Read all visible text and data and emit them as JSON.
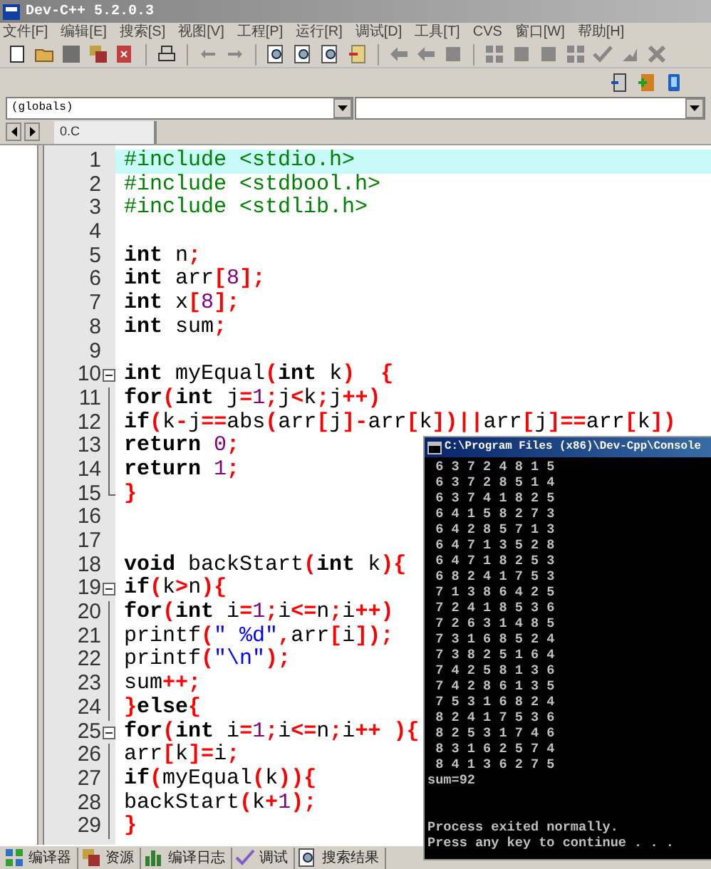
{
  "window": {
    "title": "Dev-C++ 5.2.0.3"
  },
  "menu": [
    "文件[F]",
    "编辑[E]",
    "搜索[S]",
    "视图[V]",
    "工程[P]",
    "运行[R]",
    "调试[D]",
    "工具[T]",
    "CVS",
    "窗口[W]",
    "帮助[H]"
  ],
  "scope_combo": {
    "value": "(globals)"
  },
  "file_tabs": [
    {
      "label": "0.C",
      "selected": true
    }
  ],
  "editor": {
    "lines": [
      {
        "number": "1",
        "current": true,
        "segments": [
          {
            "kind": "pp",
            "text": "#include <stdio.h>"
          }
        ]
      },
      {
        "number": "2",
        "current": false,
        "segments": [
          {
            "kind": "pp",
            "text": "#include <stdbool.h>"
          }
        ]
      },
      {
        "number": "3",
        "current": false,
        "segments": [
          {
            "kind": "pp",
            "text": "#include <stdlib.h>"
          }
        ]
      },
      {
        "number": "4",
        "current": false
      },
      {
        "number": "5",
        "current": false,
        "segments": [
          {
            "kind": "kw",
            "text": "int"
          },
          {
            "kind": "id",
            "text": " n"
          },
          {
            "kind": "sym",
            "text": ";"
          }
        ]
      },
      {
        "number": "6",
        "current": false,
        "segments": [
          {
            "kind": "kw",
            "text": "int"
          },
          {
            "kind": "id",
            "text": " arr"
          },
          {
            "kind": "sym",
            "text": "["
          },
          {
            "kind": "num",
            "text": "8"
          },
          {
            "kind": "sym",
            "text": "];"
          }
        ]
      },
      {
        "number": "7",
        "current": false,
        "segments": [
          {
            "kind": "kw",
            "text": "int"
          },
          {
            "kind": "id",
            "text": " x"
          },
          {
            "kind": "sym",
            "text": "["
          },
          {
            "kind": "num",
            "text": "8"
          },
          {
            "kind": "sym",
            "text": "];"
          }
        ]
      },
      {
        "number": "8",
        "current": false,
        "segments": [
          {
            "kind": "kw",
            "text": "int"
          },
          {
            "kind": "id",
            "text": " sum"
          },
          {
            "kind": "sym",
            "text": ";"
          }
        ]
      },
      {
        "number": "9",
        "current": false
      },
      {
        "number": "10",
        "current": false,
        "kind": "fold_start",
        "segments": [
          {
            "kind": "kw",
            "text": "int"
          },
          {
            "kind": "id",
            "text": " myEqual"
          },
          {
            "kind": "sym",
            "text": "("
          },
          {
            "kind": "kw",
            "text": "int"
          },
          {
            "kind": "id",
            "text": " k"
          },
          {
            "kind": "sym",
            "text": ")  {"
          }
        ]
      },
      {
        "number": "11",
        "current": false,
        "kind": "fold_inner",
        "segments": [
          {
            "kind": "kw",
            "text": "for"
          },
          {
            "kind": "sym",
            "text": "("
          },
          {
            "kind": "kw",
            "text": "int"
          },
          {
            "kind": "id",
            "text": " j"
          },
          {
            "kind": "sym",
            "text": "="
          },
          {
            "kind": "num",
            "text": "1"
          },
          {
            "kind": "sym",
            "text": ";"
          },
          {
            "kind": "id",
            "text": "j"
          },
          {
            "kind": "sym",
            "text": "<"
          },
          {
            "kind": "id",
            "text": "k"
          },
          {
            "kind": "sym",
            "text": ";"
          },
          {
            "kind": "id",
            "text": "j"
          },
          {
            "kind": "sym",
            "text": "++)"
          }
        ]
      },
      {
        "number": "12",
        "current": false,
        "kind": "fold_inner",
        "segments": [
          {
            "kind": "kw",
            "text": "if"
          },
          {
            "kind": "sym",
            "text": "("
          },
          {
            "kind": "id",
            "text": "k"
          },
          {
            "kind": "sym",
            "text": "-"
          },
          {
            "kind": "id",
            "text": "j"
          },
          {
            "kind": "sym",
            "text": "=="
          },
          {
            "kind": "id",
            "text": "abs"
          },
          {
            "kind": "sym",
            "text": "("
          },
          {
            "kind": "id",
            "text": "arr"
          },
          {
            "kind": "sym",
            "text": "["
          },
          {
            "kind": "id",
            "text": "j"
          },
          {
            "kind": "sym",
            "text": "]-"
          },
          {
            "kind": "id",
            "text": "arr"
          },
          {
            "kind": "sym",
            "text": "["
          },
          {
            "kind": "id",
            "text": "k"
          },
          {
            "kind": "sym",
            "text": "])||"
          },
          {
            "kind": "id",
            "text": "arr"
          },
          {
            "kind": "sym",
            "text": "["
          },
          {
            "kind": "id",
            "text": "j"
          },
          {
            "kind": "sym",
            "text": "]=="
          },
          {
            "kind": "id",
            "text": "arr"
          },
          {
            "kind": "sym",
            "text": "["
          },
          {
            "kind": "id",
            "text": "k"
          },
          {
            "kind": "sym",
            "text": "])"
          }
        ]
      },
      {
        "number": "13",
        "current": false,
        "kind": "fold_inner",
        "segments": [
          {
            "kind": "kw",
            "text": "return"
          },
          {
            "kind": "num",
            "text": " 0"
          },
          {
            "kind": "sym",
            "text": ";"
          }
        ]
      },
      {
        "number": "14",
        "current": false,
        "kind": "fold_inner",
        "segments": [
          {
            "kind": "kw",
            "text": "return"
          },
          {
            "kind": "num",
            "text": " 1"
          },
          {
            "kind": "sym",
            "text": ";"
          }
        ]
      },
      {
        "number": "15",
        "current": false,
        "kind": "fold_end",
        "segments": [
          {
            "kind": "sym",
            "text": "}"
          }
        ]
      },
      {
        "number": "16",
        "current": false
      },
      {
        "number": "17",
        "current": false
      },
      {
        "number": "18",
        "current": false,
        "segments": [
          {
            "kind": "kw",
            "text": "void"
          },
          {
            "kind": "id",
            "text": " backStart"
          },
          {
            "kind": "sym",
            "text": "("
          },
          {
            "kind": "kw",
            "text": "int"
          },
          {
            "kind": "id",
            "text": " k"
          },
          {
            "kind": "sym",
            "text": "){"
          }
        ]
      },
      {
        "number": "19",
        "current": false,
        "kind": "fold_start",
        "segments": [
          {
            "kind": "kw",
            "text": "if"
          },
          {
            "kind": "sym",
            "text": "("
          },
          {
            "kind": "id",
            "text": "k"
          },
          {
            "kind": "sym",
            "text": ">"
          },
          {
            "kind": "id",
            "text": "n"
          },
          {
            "kind": "sym",
            "text": "){"
          }
        ]
      },
      {
        "number": "20",
        "current": false,
        "kind": "fold_inner",
        "segments": [
          {
            "kind": "kw",
            "text": "for"
          },
          {
            "kind": "sym",
            "text": "("
          },
          {
            "kind": "kw",
            "text": "int"
          },
          {
            "kind": "id",
            "text": " i"
          },
          {
            "kind": "sym",
            "text": "="
          },
          {
            "kind": "num",
            "text": "1"
          },
          {
            "kind": "sym",
            "text": ";"
          },
          {
            "kind": "id",
            "text": "i"
          },
          {
            "kind": "sym",
            "text": "<="
          },
          {
            "kind": "id",
            "text": "n"
          },
          {
            "kind": "sym",
            "text": ";"
          },
          {
            "kind": "id",
            "text": "i"
          },
          {
            "kind": "sym",
            "text": "++)"
          }
        ]
      },
      {
        "number": "21",
        "current": false,
        "kind": "fold_inner",
        "segments": [
          {
            "kind": "id",
            "text": "printf"
          },
          {
            "kind": "sym",
            "text": "("
          },
          {
            "kind": "str",
            "text": "\" %d\""
          },
          {
            "kind": "sym",
            "text": ","
          },
          {
            "kind": "id",
            "text": "arr"
          },
          {
            "kind": "sym",
            "text": "["
          },
          {
            "kind": "id",
            "text": "i"
          },
          {
            "kind": "sym",
            "text": "]);"
          }
        ]
      },
      {
        "number": "22",
        "current": false,
        "kind": "fold_inner",
        "segments": [
          {
            "kind": "id",
            "text": "printf"
          },
          {
            "kind": "sym",
            "text": "("
          },
          {
            "kind": "str",
            "text": "\"\\n\""
          },
          {
            "kind": "sym",
            "text": ");"
          }
        ]
      },
      {
        "number": "23",
        "current": false,
        "kind": "fold_inner",
        "segments": [
          {
            "kind": "id",
            "text": "sum"
          },
          {
            "kind": "sym",
            "text": "++;"
          }
        ]
      },
      {
        "number": "24",
        "current": false,
        "kind": "fold_inner",
        "segments": [
          {
            "kind": "sym",
            "text": "}"
          },
          {
            "kind": "kw",
            "text": "else"
          },
          {
            "kind": "sym",
            "text": "{"
          }
        ]
      },
      {
        "number": "25",
        "current": false,
        "kind": "fold_start",
        "segments": [
          {
            "kind": "kw",
            "text": "for"
          },
          {
            "kind": "sym",
            "text": "("
          },
          {
            "kind": "kw",
            "text": "int"
          },
          {
            "kind": "id",
            "text": " i"
          },
          {
            "kind": "sym",
            "text": "="
          },
          {
            "kind": "num",
            "text": "1"
          },
          {
            "kind": "sym",
            "text": ";"
          },
          {
            "kind": "id",
            "text": "i"
          },
          {
            "kind": "sym",
            "text": "<="
          },
          {
            "kind": "id",
            "text": "n"
          },
          {
            "kind": "sym",
            "text": ";"
          },
          {
            "kind": "id",
            "text": "i"
          },
          {
            "kind": "sym",
            "text": "++ ){"
          }
        ]
      },
      {
        "number": "26",
        "current": false,
        "kind": "fold_inner",
        "segments": [
          {
            "kind": "id",
            "text": "arr"
          },
          {
            "kind": "sym",
            "text": "["
          },
          {
            "kind": "id",
            "text": "k"
          },
          {
            "kind": "sym",
            "text": "]="
          },
          {
            "kind": "id",
            "text": "i"
          },
          {
            "kind": "sym",
            "text": ";"
          }
        ]
      },
      {
        "number": "27",
        "current": false,
        "kind": "fold_inner",
        "segments": [
          {
            "kind": "kw",
            "text": "if"
          },
          {
            "kind": "sym",
            "text": "("
          },
          {
            "kind": "id",
            "text": "myEqual"
          },
          {
            "kind": "sym",
            "text": "("
          },
          {
            "kind": "id",
            "text": "k"
          },
          {
            "kind": "sym",
            "text": ")){"
          }
        ]
      },
      {
        "number": "28",
        "current": false,
        "kind": "fold_inner",
        "segments": [
          {
            "kind": "id",
            "text": "backStart"
          },
          {
            "kind": "sym",
            "text": "("
          },
          {
            "kind": "id",
            "text": "k"
          },
          {
            "kind": "sym",
            "text": "+"
          },
          {
            "kind": "num",
            "text": "1"
          },
          {
            "kind": "sym",
            "text": ");"
          }
        ]
      },
      {
        "number": "29",
        "current": false,
        "kind": "fold_inner",
        "segments": [
          {
            "kind": "sym",
            "text": "}"
          }
        ]
      }
    ]
  },
  "console": {
    "title": "C:\\Program Files (x86)\\Dev-Cpp\\Console",
    "output": [
      " 6 3 7 2 4 8 1 5",
      " 6 3 7 2 8 5 1 4",
      " 6 3 7 4 1 8 2 5",
      " 6 4 1 5 8 2 7 3",
      " 6 4 2 8 5 7 1 3",
      " 6 4 7 1 3 5 2 8",
      " 6 4 7 1 8 2 5 3",
      " 6 8 2 4 1 7 5 3",
      " 7 1 3 8 6 4 2 5",
      " 7 2 4 1 8 5 3 6",
      " 7 2 6 3 1 4 8 5",
      " 7 3 1 6 8 5 2 4",
      " 7 3 8 2 5 1 6 4",
      " 7 4 2 5 8 1 3 6",
      " 7 4 2 8 6 1 3 5",
      " 7 5 3 1 6 8 2 4",
      " 8 2 4 1 7 5 3 6",
      " 8 2 5 3 1 7 4 6",
      " 8 3 1 6 2 5 7 4",
      " 8 4 1 3 6 2 7 5",
      "sum=92"
    ],
    "messages": [
      "Process exited normally.",
      "Press any key to continue . . ."
    ]
  },
  "bottom_tabs": [
    {
      "label": "编译器"
    },
    {
      "label": "资源"
    },
    {
      "label": "编译日志"
    },
    {
      "label": "调试"
    },
    {
      "label": "搜索结果"
    }
  ]
}
